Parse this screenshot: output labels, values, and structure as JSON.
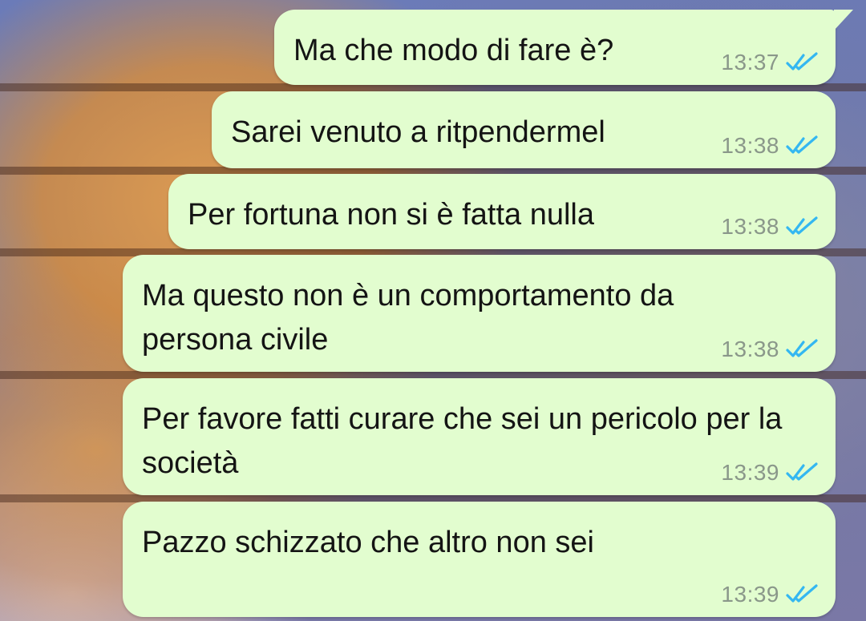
{
  "colors": {
    "bubble_background": "#e2fdcf",
    "text": "#141414",
    "timestamp": "#8a978a",
    "read_ticks": "#34b7f1"
  },
  "messages": [
    {
      "text": "Ma che modo di fare è?",
      "time": "13:37",
      "status_icon": "double-check-read-icon"
    },
    {
      "text": "Sarei venuto a ritpendermel",
      "time": "13:38",
      "status_icon": "double-check-read-icon"
    },
    {
      "text": "Per fortuna non si è fatta nulla",
      "time": "13:38",
      "status_icon": "double-check-read-icon"
    },
    {
      "text": "Ma questo non è un comportamento da persona civile",
      "time": "13:38",
      "status_icon": "double-check-read-icon"
    },
    {
      "text": "Per favore fatti curare che sei un pericolo per la società",
      "time": "13:39",
      "status_icon": "double-check-read-icon"
    },
    {
      "text": "Pazzo schizzato che altro non sei",
      "time": "13:39",
      "status_icon": "double-check-read-icon"
    }
  ]
}
